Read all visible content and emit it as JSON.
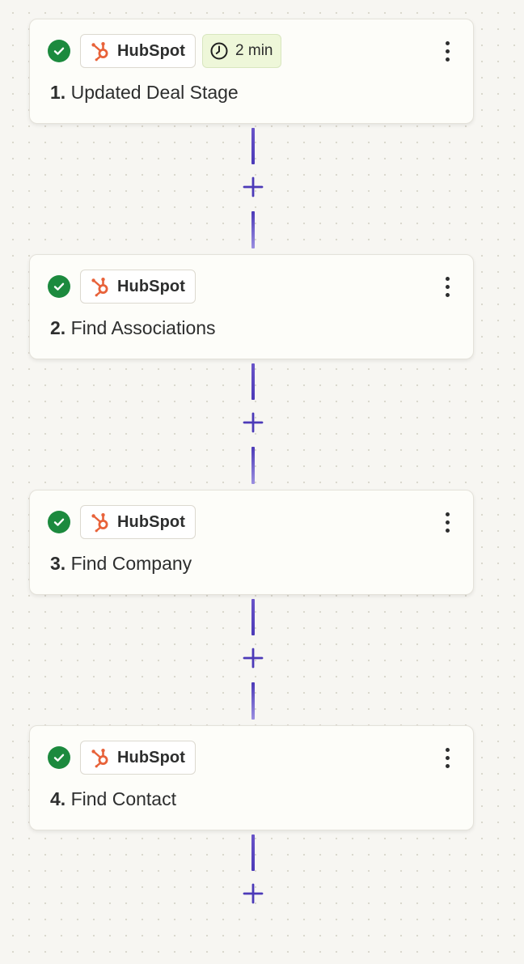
{
  "steps": [
    {
      "number": "1.",
      "title": "Updated Deal Stage",
      "app": "HubSpot",
      "status": "success",
      "time": "2 min"
    },
    {
      "number": "2.",
      "title": "Find Associations",
      "app": "HubSpot",
      "status": "success"
    },
    {
      "number": "3.",
      "title": "Find Company",
      "app": "HubSpot",
      "status": "success"
    },
    {
      "number": "4.",
      "title": "Find Contact",
      "app": "HubSpot",
      "status": "success"
    }
  ],
  "colors": {
    "success": "#1c8a3e",
    "hubspot": "#e8623a",
    "connector": "#4c3ab8",
    "time_badge": "#eef7d9"
  },
  "icons": {
    "status": "check-circle-icon",
    "app": "hubspot-logo-icon",
    "time": "clock-icon",
    "menu": "more-vertical-icon",
    "add": "plus-icon"
  }
}
